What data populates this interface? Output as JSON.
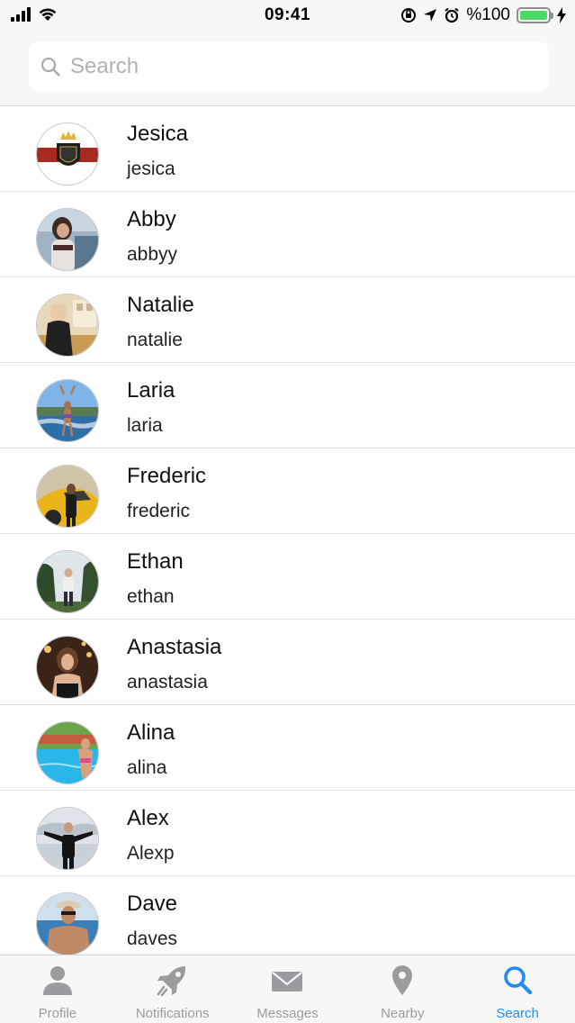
{
  "status_bar": {
    "time": "09:41",
    "battery_text": "%100",
    "battery_level": 1.0,
    "icons": [
      "signal-icon",
      "wifi-icon",
      "orientation-lock-icon",
      "location-icon",
      "alarm-icon",
      "charging-icon"
    ]
  },
  "search": {
    "placeholder": "Search",
    "value": ""
  },
  "users": [
    {
      "name": "Jesica",
      "handle": "jesica"
    },
    {
      "name": "Abby",
      "handle": "abbyy"
    },
    {
      "name": "Natalie",
      "handle": "natalie"
    },
    {
      "name": "Laria",
      "handle": "laria"
    },
    {
      "name": "Frederic",
      "handle": "frederic"
    },
    {
      "name": "Ethan",
      "handle": "ethan"
    },
    {
      "name": "Anastasia",
      "handle": "anastasia"
    },
    {
      "name": "Alina",
      "handle": "alina"
    },
    {
      "name": "Alex",
      "handle": "Alexp"
    },
    {
      "name": "Dave",
      "handle": "daves"
    }
  ],
  "tabs": [
    {
      "label": "Profile",
      "icon": "person-icon",
      "active": false
    },
    {
      "label": "Notifications",
      "icon": "rocket-icon",
      "active": false
    },
    {
      "label": "Messages",
      "icon": "envelope-icon",
      "active": false
    },
    {
      "label": "Nearby",
      "icon": "map-pin-icon",
      "active": false
    },
    {
      "label": "Search",
      "icon": "search-icon",
      "active": true
    }
  ],
  "colors": {
    "accent": "#1d8cf8",
    "tab_inactive": "#9b9b9f",
    "battery": "#4cd964"
  }
}
